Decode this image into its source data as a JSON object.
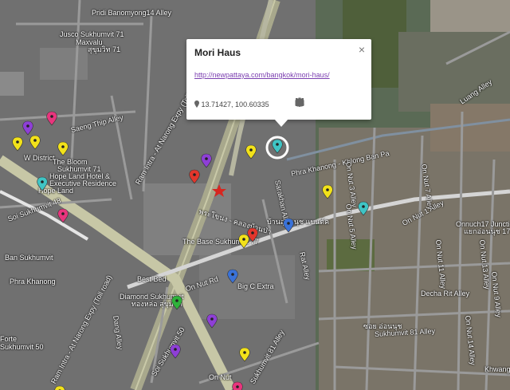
{
  "popup": {
    "title": "Mori Haus",
    "close_glyph": "×",
    "link": "http://newpattaya.com/bangkok/mori-haus/",
    "coords": "13.71427, 100.60335",
    "tools": [
      "paint-bucket-icon",
      "pencil-icon",
      "camera-icon",
      "directions-icon",
      "trash-icon"
    ]
  },
  "labels": {
    "pridi": "Pridi Banomyong14 Alley",
    "jusco": "Jusco Sukhumvit 71",
    "maxvalu": "Maxvalu",
    "maxvalu_th": "สุขุมวิท 71",
    "saeng_thip": "Saeng Thip Alley",
    "w_district": "W District",
    "bloom1": "The Bloom",
    "bloom2": "Sukhumvit 71",
    "hope1": "Hope Land Hotel &",
    "hope2": "Executive Residence",
    "hope3": "Hope Land",
    "sukh48": "Soi Sukhumvit 48",
    "phra_khanong": "Phra Khanong",
    "expy1": "Ram Intra - At Narong Expy (Toll road)",
    "expy2": "Ram Intra - At Narong Expy (Toll road)",
    "khlong": "Phra Khanong - Khlong Ban Pa",
    "base": "The Base Sukhumvit 77",
    "on_nut_th": "บ้านอ่อนนุช แบนด์ค",
    "on_nut_rd": "On Nut Rd",
    "best_bed": "Best Bed",
    "bigc": "Big C Extra",
    "diamond1": "Diamond Sukhumvit",
    "diamond2": "ทองหล่อ สุขุมวิท",
    "sukh50": "Soi Sukhumvit 50",
    "on_nut_sta": "On Nut",
    "sukh81": "Sukhumvit 81 Alley",
    "onnut17": "Onnuch17 Junction",
    "onnut17_th": "แยกอ่อนนุช 17",
    "decha": "Decha Rit Alley",
    "khwang": "Khwang",
    "nut3": "On Nut 3 Alley",
    "nut1": "On Nut 1 Alley",
    "nut7": "On Nut 7 Alley",
    "nut9": "On Nut 9 Alley",
    "nut13": "On Nut 13 Alley",
    "nut14": "On Nut 14 Alley",
    "nut5": "On Nut 5 Alley",
    "nut11": "On Nut 11 Alley",
    "sukh_alley": "Sukhumvit 81 Alley",
    "soi_th": "ซอย อ่อนนุช",
    "lueng": "Luang Alley",
    "sarakhan": "Sarakhan Alley",
    "dang": "Dang Alley",
    "sukh50b": "Sukhumvit 50",
    "forte": "Forte",
    "thai_sign": "พระโขนง - คลองบ้านป่า",
    "ban_sukhum": "Ban Sukhumvit",
    "rat": "Rat Alley"
  },
  "colors": {
    "purple": "#8e3fd6",
    "yellow": "#f2e21a",
    "pink": "#e8357d",
    "red": "#e2362c",
    "blue": "#3a72d8",
    "teal": "#3fc4c4",
    "green": "#2fb23a",
    "star": "#d7261f"
  }
}
